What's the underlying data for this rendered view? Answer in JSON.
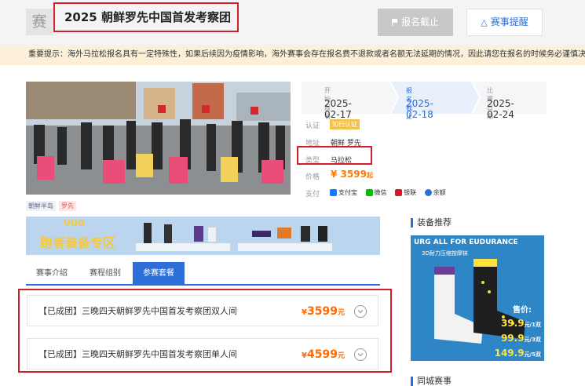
{
  "header": {
    "logo_char": "赛",
    "title": "2025 朝鲜罗先中国首发考察团",
    "closed_label": "报名截止",
    "remind_label": "赛事提醒"
  },
  "notice": {
    "text": "重要提示：海外马拉松报名具有一定特殊性，如果后续因为疫情影响，海外赛事会存在报名费不退款或者名额无法延期的情况，因此请您在报名的时候务必谨慎决定"
  },
  "tags": [
    "朝鲜半岛",
    "罗先"
  ],
  "timeline": [
    {
      "label": "开始报名",
      "date": "2025-02-17",
      "active": false
    },
    {
      "label": "报名截止",
      "date": "2025-02-18",
      "active": true
    },
    {
      "label": "比赛日期",
      "date": "2025-02-24",
      "active": false
    }
  ],
  "info": {
    "auth_label": "认证",
    "auth_badge": "知行认证",
    "addr_label": "地址",
    "addr_value": "朝鲜 罗先",
    "type_label": "类型",
    "type_value": "马拉松",
    "price_label": "价格",
    "price_currency": "¥",
    "price_value": "3599",
    "price_suffix": "起",
    "pay_label": "支付",
    "payments": [
      {
        "name": "支付宝",
        "color": "#1677ff"
      },
      {
        "name": "微信",
        "color": "#09bb07"
      },
      {
        "name": "银联",
        "color": "#d7182a"
      },
      {
        "name": "余额",
        "color": "#2c6fd8"
      }
    ]
  },
  "banner": {
    "logo": "UUG",
    "text": "跑者装备专区"
  },
  "tabs": [
    {
      "label": "赛事介绍",
      "active": false
    },
    {
      "label": "赛程组别",
      "active": false
    },
    {
      "label": "参赛套餐",
      "active": true
    }
  ],
  "packages": [
    {
      "name": "【已成团】三晚四天朝鲜罗先中国首发考察团双人间",
      "currency": "¥",
      "price": "3599",
      "unit": "元"
    },
    {
      "name": "【已成团】三晚四天朝鲜罗先中国首发考察团单人间",
      "currency": "¥",
      "price": "4599",
      "unit": "元"
    }
  ],
  "sidebar": {
    "gear_title": "装备推荐",
    "recent_title": "同城赛事",
    "ad": {
      "headline": "URG ALL FOR EUDURANCE",
      "sub": "3D耐力压缩按摩袜",
      "price_label": "售价:",
      "prices": [
        {
          "value": "39.9",
          "unit": "元/1双"
        },
        {
          "value": "99.9",
          "unit": "元/3双"
        },
        {
          "value": "149.9",
          "unit": "元/5双"
        }
      ]
    }
  },
  "colors": {
    "accent": "#2c6fd8",
    "highlight": "#d21e2a",
    "price": "#ff6a00"
  }
}
